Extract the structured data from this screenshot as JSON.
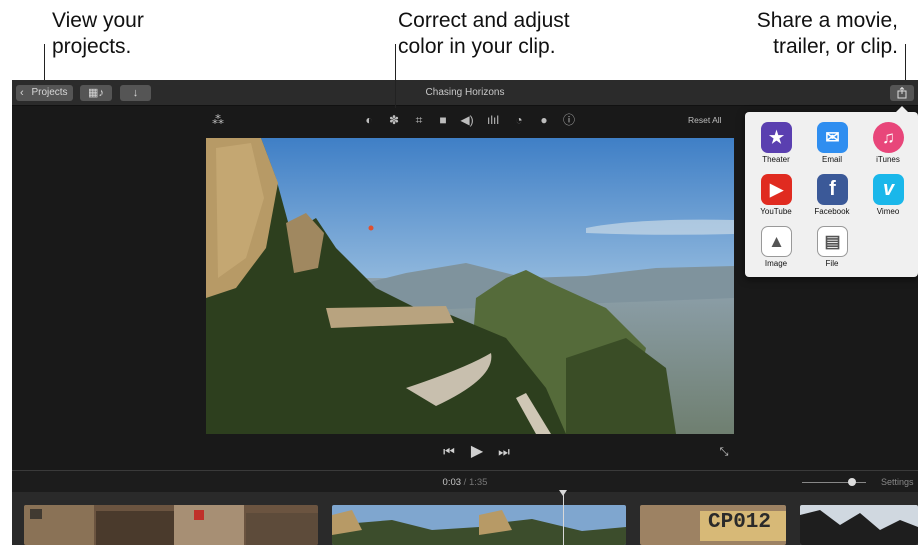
{
  "callouts": {
    "projects": [
      "View your",
      "projects."
    ],
    "color": [
      "Correct and adjust",
      "color in your clip."
    ],
    "share": [
      "Share a movie,",
      "trailer, or clip."
    ]
  },
  "titlebar": {
    "projects_label": "Projects",
    "title": "Chasing Horizons"
  },
  "toolbar": {
    "reset_all": "Reset All"
  },
  "share_menu": {
    "items": [
      {
        "label": "Theater",
        "icon": "theater-icon",
        "color": "#5a3fb0"
      },
      {
        "label": "Email",
        "icon": "email-icon",
        "color": "#2f8ef0"
      },
      {
        "label": "iTunes",
        "icon": "itunes-icon",
        "color": "#e8467a"
      },
      {
        "label": "YouTube",
        "icon": "youtube-icon",
        "color": "#e02b20"
      },
      {
        "label": "Facebook",
        "icon": "facebook-icon",
        "color": "#3b5998"
      },
      {
        "label": "Vimeo",
        "icon": "vimeo-icon",
        "color": "#1ab7ea"
      },
      {
        "label": "Image",
        "icon": "image-icon",
        "color": "#ffffff"
      },
      {
        "label": "File",
        "icon": "file-icon",
        "color": "#ffffff"
      }
    ]
  },
  "timeline": {
    "current_time": "0:03",
    "separator": "/",
    "duration": "1:35",
    "settings_label": "Settings",
    "clip_text": "CP012"
  }
}
